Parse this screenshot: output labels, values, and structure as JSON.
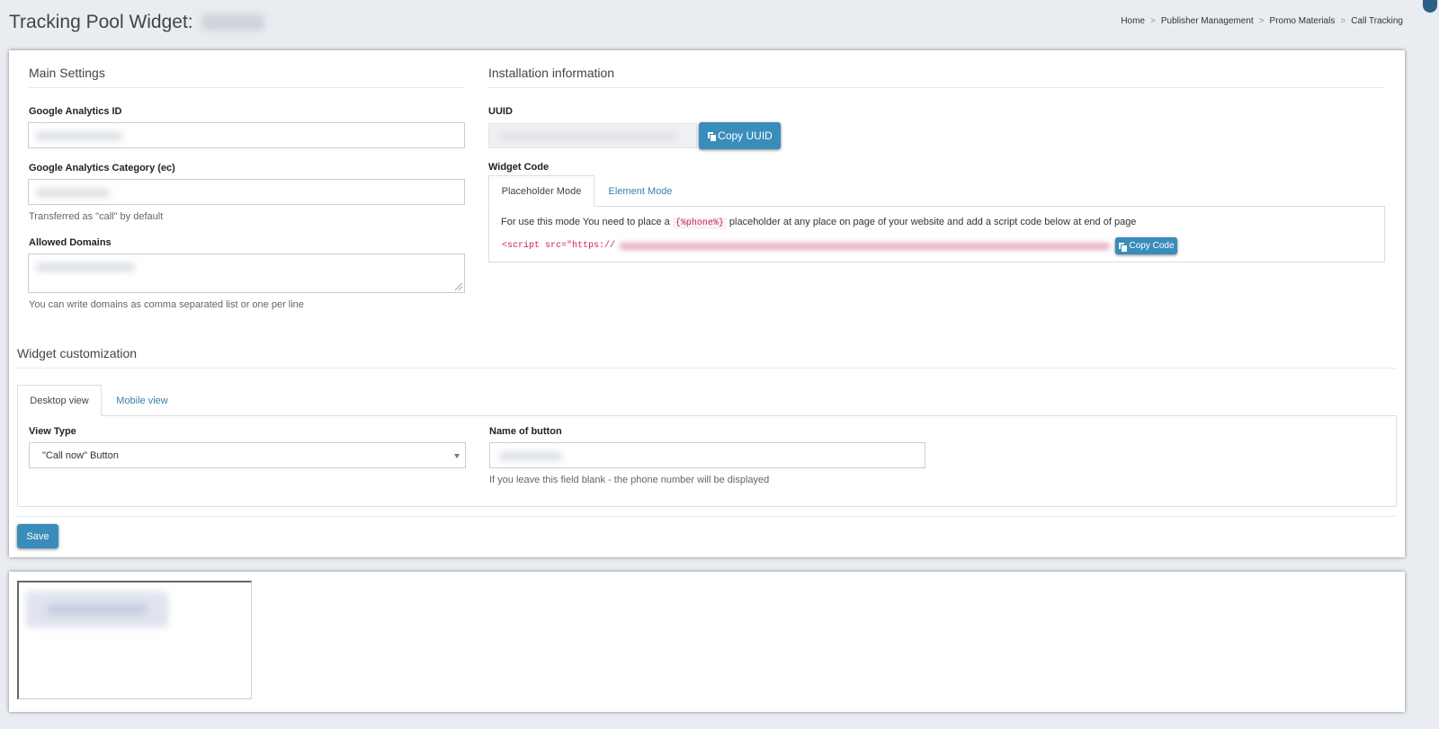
{
  "header": {
    "title": "Tracking Pool Widget:",
    "breadcrumb": [
      "Home",
      "Publisher Management",
      "Promo Materials",
      "Call Tracking"
    ]
  },
  "main_settings": {
    "title": "Main Settings",
    "ga_id_label": "Google Analytics ID",
    "ga_category_label": "Google Analytics Category (ec)",
    "ga_category_help": "Transferred as \"call\" by default",
    "allowed_domains_label": "Allowed Domains",
    "allowed_domains_help": "You can write domains as comma separated list or one per line"
  },
  "installation": {
    "title": "Installation information",
    "uuid_label": "UUID",
    "copy_uuid_label": "Copy UUID",
    "widget_code_label": "Widget Code",
    "tabs": [
      "Placeholder Mode",
      "Element Mode"
    ],
    "instruction_before": "For use this mode You need to place a",
    "placeholder_code": "{%phone%}",
    "instruction_after": "placeholder at any place on page of your website and add a script code below at end of page",
    "script_prefix": "<script src=\"https://",
    "copy_code_label": "Copy Code"
  },
  "customization": {
    "title": "Widget customization",
    "tabs": [
      "Desktop view",
      "Mobile view"
    ],
    "view_type_label": "View Type",
    "view_type_value": "\"Call now\" Button",
    "button_name_label": "Name of button",
    "button_name_help": "If you leave this field blank - the phone number will be displayed"
  },
  "save_label": "Save",
  "colors": {
    "primary": "#3a8dbb",
    "link": "#3a7fab",
    "code": "#c7254e"
  }
}
